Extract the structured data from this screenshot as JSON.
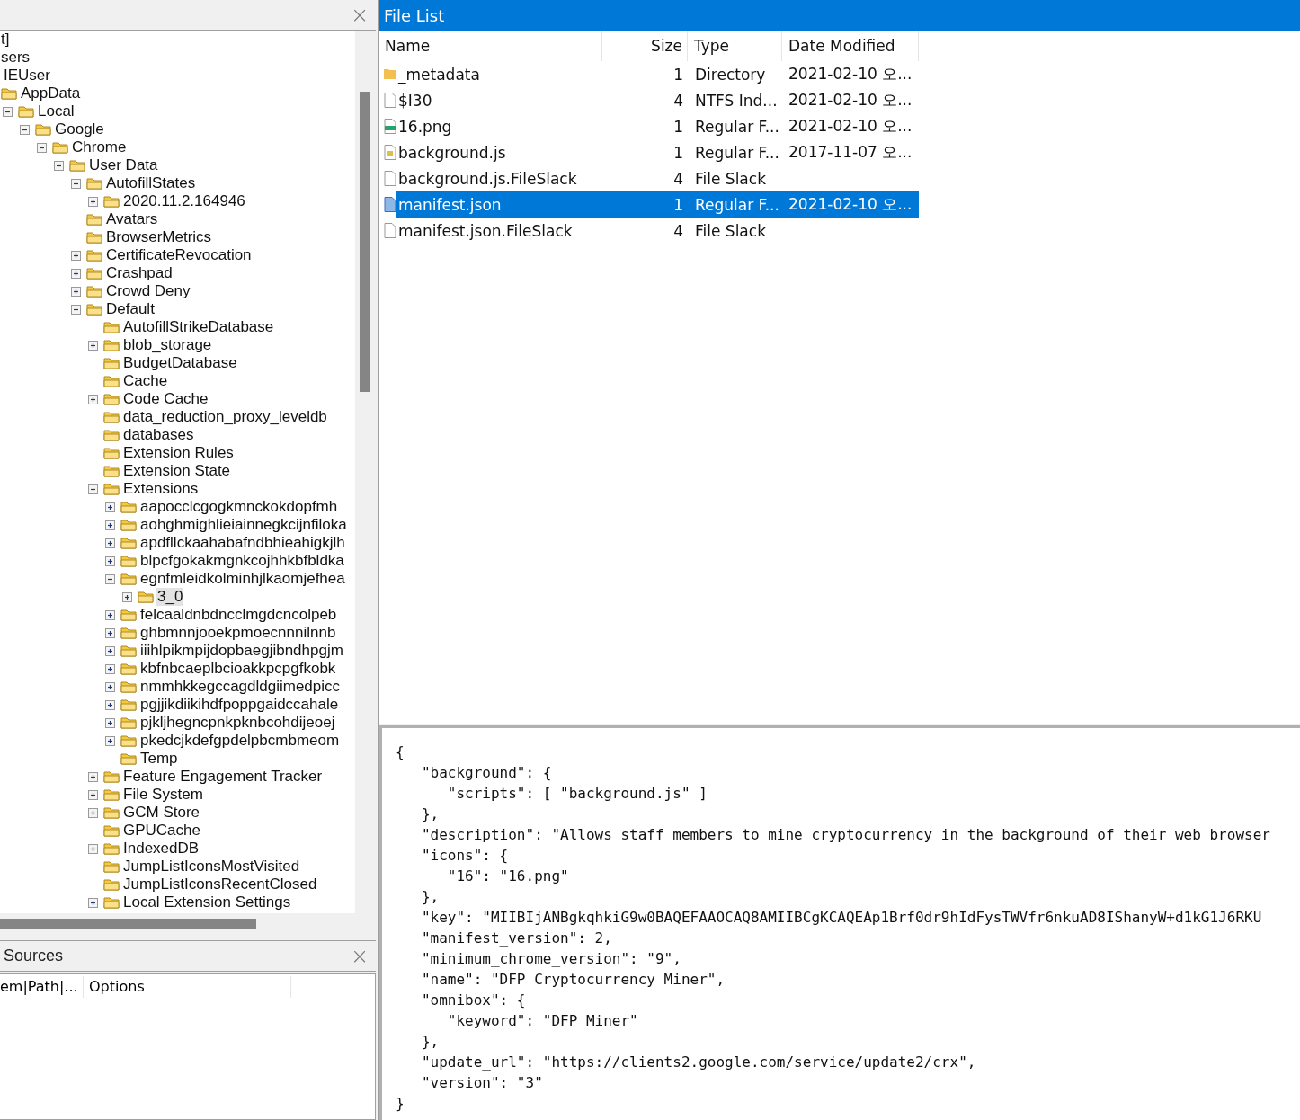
{
  "tree_panel": {
    "close": "×",
    "nodes": [
      {
        "label": "t]",
        "kind": "leaf",
        "selected": false,
        "children": [
          {
            "label": "sers",
            "kind": "leaf",
            "selected": false,
            "children": [
              {
                "label": "IEUser",
                "kind": "leaf",
                "selected": false,
                "children": [
                  {
                    "label": "AppData",
                    "kind": "leaf",
                    "selected": false,
                    "children": [
                      {
                        "label": "Local",
                        "kind": "branch",
                        "expanded": true,
                        "selected": false,
                        "children": [
                          {
                            "label": "Google",
                            "kind": "branch",
                            "expanded": true,
                            "selected": false,
                            "children": [
                              {
                                "label": "Chrome",
                                "kind": "branch",
                                "expanded": true,
                                "selected": false,
                                "children": [
                                  {
                                    "label": "User Data",
                                    "kind": "branch",
                                    "expanded": true,
                                    "selected": false,
                                    "children": [
                                      {
                                        "label": "AutofillStates",
                                        "kind": "branch",
                                        "expanded": true,
                                        "selected": false,
                                        "children": [
                                          {
                                            "label": "2020.11.2.164946",
                                            "kind": "branch",
                                            "expanded": false,
                                            "selected": false
                                          }
                                        ]
                                      },
                                      {
                                        "label": "Avatars",
                                        "kind": "leaf",
                                        "selected": false
                                      },
                                      {
                                        "label": "BrowserMetrics",
                                        "kind": "leaf",
                                        "selected": false
                                      },
                                      {
                                        "label": "CertificateRevocation",
                                        "kind": "branch",
                                        "expanded": false,
                                        "selected": false
                                      },
                                      {
                                        "label": "Crashpad",
                                        "kind": "branch",
                                        "expanded": false,
                                        "selected": false
                                      },
                                      {
                                        "label": "Crowd Deny",
                                        "kind": "branch",
                                        "expanded": false,
                                        "selected": false
                                      },
                                      {
                                        "label": "Default",
                                        "kind": "branch",
                                        "expanded": true,
                                        "selected": false,
                                        "children": [
                                          {
                                            "label": "AutofillStrikeDatabase",
                                            "kind": "leaf",
                                            "selected": false
                                          },
                                          {
                                            "label": "blob_storage",
                                            "kind": "branch",
                                            "expanded": false,
                                            "selected": false
                                          },
                                          {
                                            "label": "BudgetDatabase",
                                            "kind": "leaf",
                                            "selected": false
                                          },
                                          {
                                            "label": "Cache",
                                            "kind": "leaf",
                                            "selected": false
                                          },
                                          {
                                            "label": "Code Cache",
                                            "kind": "branch",
                                            "expanded": false,
                                            "selected": false
                                          },
                                          {
                                            "label": "data_reduction_proxy_leveldb",
                                            "kind": "leaf",
                                            "selected": false
                                          },
                                          {
                                            "label": "databases",
                                            "kind": "leaf",
                                            "selected": false
                                          },
                                          {
                                            "label": "Extension Rules",
                                            "kind": "leaf",
                                            "selected": false
                                          },
                                          {
                                            "label": "Extension State",
                                            "kind": "leaf",
                                            "selected": false
                                          },
                                          {
                                            "label": "Extensions",
                                            "kind": "branch",
                                            "expanded": true,
                                            "selected": false,
                                            "children": [
                                              {
                                                "label": "aapocclcgogkmnckokdopfmh",
                                                "kind": "branch",
                                                "expanded": false,
                                                "selected": false
                                              },
                                              {
                                                "label": "aohghmighlieiainnegkcijnfiloka",
                                                "kind": "branch",
                                                "expanded": false,
                                                "selected": false
                                              },
                                              {
                                                "label": "apdfllckaahabafndbhieahigkjlh",
                                                "kind": "branch",
                                                "expanded": false,
                                                "selected": false
                                              },
                                              {
                                                "label": "blpcfgokakmgnkcojhhkbfbldka",
                                                "kind": "branch",
                                                "expanded": false,
                                                "selected": false
                                              },
                                              {
                                                "label": "egnfmleidkolminhjlkaomjefhea",
                                                "kind": "branch",
                                                "expanded": true,
                                                "selected": false,
                                                "children": [
                                                  {
                                                    "label": "3_0",
                                                    "kind": "branch",
                                                    "expanded": false,
                                                    "selected": true
                                                  }
                                                ]
                                              },
                                              {
                                                "label": "felcaaldnbdncclmgdcncolpeb",
                                                "kind": "branch",
                                                "expanded": false,
                                                "selected": false
                                              },
                                              {
                                                "label": "ghbmnnjooekpmoecnnnilnnb",
                                                "kind": "branch",
                                                "expanded": false,
                                                "selected": false
                                              },
                                              {
                                                "label": "iiihlpikmpijdopbaegjibndhpgjm",
                                                "kind": "branch",
                                                "expanded": false,
                                                "selected": false
                                              },
                                              {
                                                "label": "kbfnbcaeplbcioakkpcpgfkobk",
                                                "kind": "branch",
                                                "expanded": false,
                                                "selected": false
                                              },
                                              {
                                                "label": "nmmhkkegccagdldgiimedpicc",
                                                "kind": "branch",
                                                "expanded": false,
                                                "selected": false
                                              },
                                              {
                                                "label": "pgjjikdiikihdfpoppgaidccahale",
                                                "kind": "branch",
                                                "expanded": false,
                                                "selected": false
                                              },
                                              {
                                                "label": "pjkljhegncpnkpknbcohdijeoej",
                                                "kind": "branch",
                                                "expanded": false,
                                                "selected": false
                                              },
                                              {
                                                "label": "pkedcjkdefgpdelpbcmbmeom",
                                                "kind": "branch",
                                                "expanded": false,
                                                "selected": false
                                              },
                                              {
                                                "label": "Temp",
                                                "kind": "leaf",
                                                "selected": false
                                              }
                                            ]
                                          },
                                          {
                                            "label": "Feature Engagement Tracker",
                                            "kind": "branch",
                                            "expanded": false,
                                            "selected": false
                                          },
                                          {
                                            "label": "File System",
                                            "kind": "branch",
                                            "expanded": false,
                                            "selected": false
                                          },
                                          {
                                            "label": "GCM Store",
                                            "kind": "branch",
                                            "expanded": false,
                                            "selected": false
                                          },
                                          {
                                            "label": "GPUCache",
                                            "kind": "leaf",
                                            "selected": false
                                          },
                                          {
                                            "label": "IndexedDB",
                                            "kind": "branch",
                                            "expanded": false,
                                            "selected": false
                                          },
                                          {
                                            "label": "JumpListIconsMostVisited",
                                            "kind": "leaf",
                                            "selected": false
                                          },
                                          {
                                            "label": "JumpListIconsRecentClosed",
                                            "kind": "leaf",
                                            "selected": false
                                          },
                                          {
                                            "label": "Local Extension Settings",
                                            "kind": "branch",
                                            "expanded": false,
                                            "selected": false
                                          }
                                        ]
                                      }
                                    ]
                                  }
                                ]
                              }
                            ]
                          }
                        ]
                      }
                    ]
                  }
                ]
              }
            ]
          }
        ]
      }
    ]
  },
  "sources_panel": {
    "title": "Sources",
    "close": "×",
    "columns": [
      "em|Path|...",
      "Options"
    ]
  },
  "file_list": {
    "title": "File List",
    "columns": [
      "Name",
      "Size",
      "Type",
      "Date Modified"
    ],
    "rows": [
      {
        "kind": "folder",
        "name": "_metadata",
        "size": "1",
        "type": "Directory",
        "date": "2021-02-10 오...",
        "selected": false
      },
      {
        "kind": "file",
        "name": "$I30",
        "size": "4",
        "type": "NTFS Ind...",
        "date": "2021-02-10 오...",
        "selected": false
      },
      {
        "kind": "image",
        "name": "16.png",
        "size": "1",
        "type": "Regular F...",
        "date": "2021-02-10 오...",
        "selected": false
      },
      {
        "kind": "script",
        "name": "background.js",
        "size": "1",
        "type": "Regular F...",
        "date": "2017-11-07 오...",
        "selected": false
      },
      {
        "kind": "file",
        "name": "background.js.FileSlack",
        "size": "4",
        "type": "File Slack",
        "selected": false
      },
      {
        "kind": "data",
        "name": "manifest.json",
        "size": "1",
        "type": "Regular F...",
        "date": "2021-02-10 오...",
        "selected": true
      },
      {
        "kind": "file",
        "name": "manifest.json.FileSlack",
        "size": "4",
        "type": "File Slack",
        "selected": false
      }
    ]
  },
  "file_content": {
    "lines": [
      "{",
      "   \"background\": {",
      "      \"scripts\": [ \"background.js\" ]",
      "   },",
      "   \"description\": \"Allows staff members to mine cryptocurrency in the background of their web browser",
      "   \"icons\": {",
      "      \"16\": \"16.png\"",
      "   },",
      "   \"key\": \"MIIBIjANBgkqhkiG9w0BAQEFAAOCAQ8AMIIBCgKCAQEAp1Brf0dr9hIdFysTWVfr6nkuAD8IShanyW+d1kG1J6RKU",
      "   \"manifest_version\": 2,",
      "   \"minimum_chrome_version\": \"9\",",
      "   \"name\": \"DFP Cryptocurrency Miner\",",
      "   \"omnibox\": {",
      "      \"keyword\": \"DFP Miner\"",
      "   },",
      "   \"update_url\": \"https://clients2.google.com/service/update2/crx\",",
      "   \"version\": \"3\"",
      "}"
    ]
  }
}
